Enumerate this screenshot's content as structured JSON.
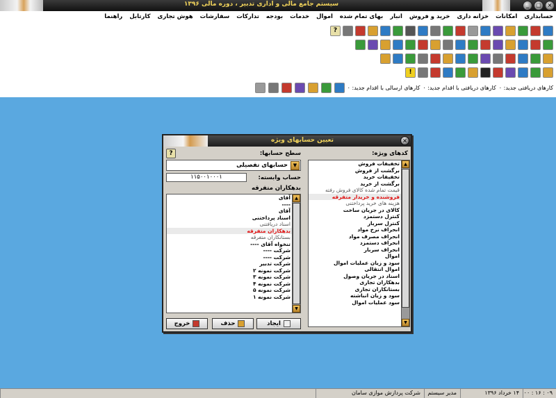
{
  "window": {
    "title": "سیستم جامع مالی و اداری تدبیر ، دوره مالی ۱۳۹۶",
    "min": "_",
    "max": "▢",
    "close": "×"
  },
  "menu": [
    "حسابداری",
    "امکانات",
    "خزانه داری",
    "خرید و فروش",
    "انبار",
    "بهای تمام شده",
    "اموال",
    "خدمات",
    "بودجه",
    "تدارکات",
    "سفارشات",
    "هوش تجاری",
    "کارتابل",
    "راهنما"
  ],
  "toolbar_status": {
    "new_received": "کارهای دریافتی جدید: ۰",
    "received_action": "کارهای دریافتی با اقدام جدید: ۰",
    "sent_action": "کارهای ارسالی با اقدام جدید: ۰"
  },
  "dialog": {
    "title": "تعیین حسابهای ویژه",
    "close": "×",
    "help": "?",
    "special_codes_label": "کدهای ویژه:",
    "account_level_label": "سطح حسابها:",
    "account_level_value": "حسابهای تفصیلی",
    "linked_account_label": "حساب وابسته:",
    "linked_account_value": "۱۱۵۰۰۱۰۰۰۱",
    "linked_account_name": "بدهکاران متفرقه",
    "special_codes": [
      {
        "text": "تخفیفات فروش"
      },
      {
        "text": "برگشت از فروش"
      },
      {
        "text": "تخفیفات خرید"
      },
      {
        "text": "برگشت از خرید"
      },
      {
        "text": "قیمت تمام شده کالای فروش رفته",
        "style": "sub"
      },
      {
        "text": "فروشنده و خریدار متفرقه",
        "style": "hl"
      },
      {
        "text": "هزینه های خرید پرداختنی",
        "style": "sub"
      },
      {
        "text": "کالای در جریان ساخت"
      },
      {
        "text": "کنترل دستمزد"
      },
      {
        "text": "کنترل سربار"
      },
      {
        "text": "انحراف نرخ مواد"
      },
      {
        "text": "انحراف مصرف مواد"
      },
      {
        "text": "انحراف دستمزد"
      },
      {
        "text": "انحراف سربار"
      },
      {
        "text": "اموال"
      },
      {
        "text": "سود و زیان عملیات اموال"
      },
      {
        "text": "اموال انتقالی"
      },
      {
        "text": "اسناد در جریان وصول"
      },
      {
        "text": "بدهکاران تجاری"
      },
      {
        "text": "بستانکاران تجاری"
      },
      {
        "text": "سود و زیان انباشته"
      },
      {
        "text": "سود عملیات اموال"
      }
    ],
    "accounts": [
      {
        "text": "آقای"
      },
      {
        "text": "----"
      },
      {
        "text": "آقای"
      },
      {
        "text": "اسناد پرداختنی"
      },
      {
        "text": "اسناد دریافتنی",
        "style": "sub"
      },
      {
        "text": "بدهکاران متفرقه",
        "style": "hl"
      },
      {
        "text": "بستانکاران متفرقه",
        "style": "sub"
      },
      {
        "text": "تنخواه آقای ----"
      },
      {
        "text": "شرکت ----"
      },
      {
        "text": "شرکت ----"
      },
      {
        "text": "شرکت تدبیر"
      },
      {
        "text": "شرکت نمونه ۲"
      },
      {
        "text": "شرکت نمونه ۳"
      },
      {
        "text": "شرکت نمونه ۴"
      },
      {
        "text": "شرکت نمونه ۵"
      },
      {
        "text": "شرکت نمونه ۱"
      }
    ],
    "buttons": {
      "create": "ایجاد",
      "delete": "حذف",
      "exit": "خروج"
    }
  },
  "statusbar": {
    "time": "۰۹ : ۱۶ : ۰۰",
    "date": "۱۴ خرداد ۱۳۹۶",
    "user": "مدیر سیستم",
    "company": "شرکت پردازش موازی سامان"
  },
  "colors": {
    "desktop": "#5aa8e0",
    "highlight_text": "#e01010",
    "title_text": "#f1d35b"
  }
}
